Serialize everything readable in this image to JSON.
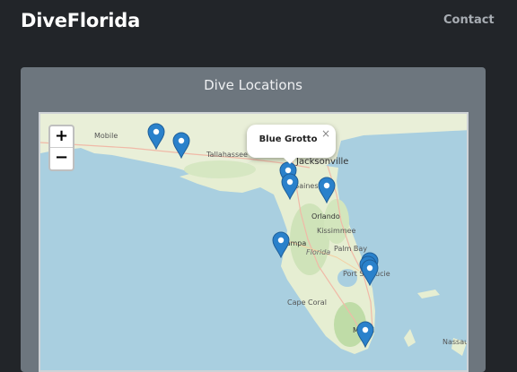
{
  "navbar": {
    "brand": "DiveFlorida",
    "contact": "Contact"
  },
  "card": {
    "title": "Dive Locations"
  },
  "map": {
    "zoom_in": "+",
    "zoom_out": "−",
    "popup": {
      "text": "Blue Grotto",
      "close": "×"
    },
    "labels": {
      "mobile": "Mobile",
      "tallahassee": "Tallahassee",
      "jacksonville": "Jacksonville",
      "gainesville": "Gainesville",
      "orlando": "Orlando",
      "kissimmee": "Kissimmee",
      "tampa": "Tampa",
      "florida": "Florida",
      "palm_bay": "Palm Bay",
      "port_st_lucie": "Port St. Lucie",
      "cape_coral": "Cape Coral",
      "miami": "Miami",
      "nassau": "Nassau"
    },
    "marker_color": "#2a81cb"
  }
}
